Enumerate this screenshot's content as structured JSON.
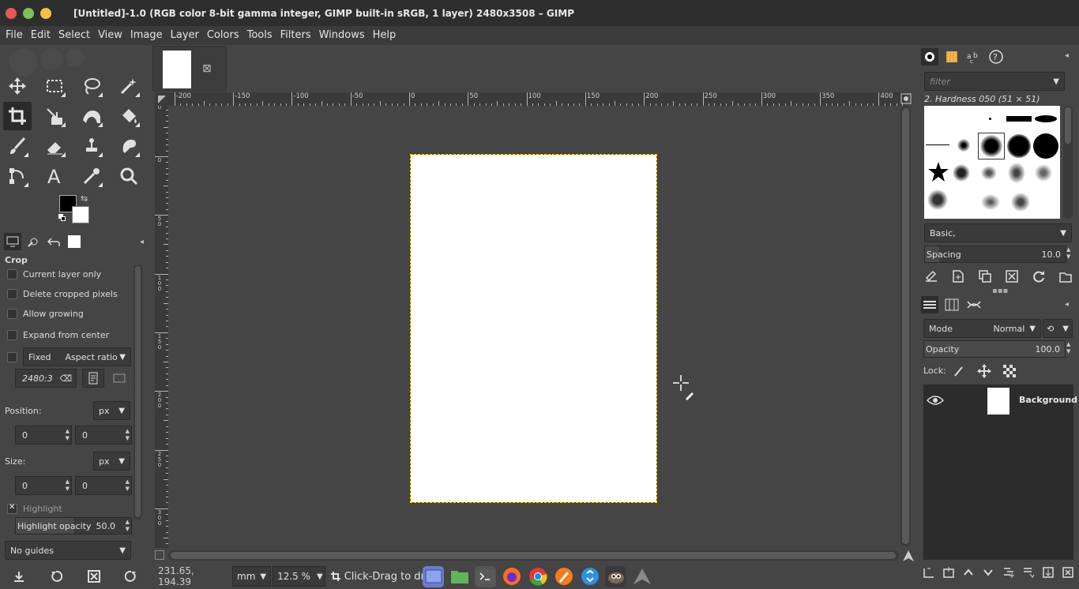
{
  "window": {
    "title": "[Untitled]-1.0 (RGB color 8-bit gamma integer, GIMP built-in sRGB, 1 layer) 2480x3508 – GIMP",
    "controls": [
      {
        "name": "close",
        "color": "#e35a5a"
      },
      {
        "name": "maximize",
        "color": "#7cc35a"
      },
      {
        "name": "minimize",
        "color": "#f2c14e"
      }
    ]
  },
  "menu": [
    "File",
    "Edit",
    "Select",
    "View",
    "Image",
    "Layer",
    "Colors",
    "Tools",
    "Filters",
    "Windows",
    "Help"
  ],
  "toolbox": {
    "tools": [
      "move-icon",
      "rect-select-icon",
      "lasso-icon",
      "fuzzy-select-icon",
      "crop-icon",
      "transform-icon",
      "warp-icon",
      "bucket-fill-icon",
      "paintbrush-icon",
      "eraser-icon",
      "clone-icon",
      "smudge-icon",
      "paths-icon",
      "text-icon",
      "color-picker-icon",
      "zoom-icon"
    ],
    "active_tool": "crop-icon",
    "fg_color": "#000000",
    "bg_color": "#ffffff"
  },
  "tool_options": {
    "title": "Crop",
    "current_layer_only": "Current layer only",
    "delete_cropped": "Delete cropped pixels",
    "allow_growing": "Allow growing",
    "expand_center": "Expand from center",
    "fixed_label": "Fixed",
    "aspect_ratio": "Aspect ratio",
    "ratio_value": "2480:3",
    "position_label": "Position:",
    "position_unit": "px",
    "pos_x": "0",
    "pos_y": "0",
    "size_label": "Size:",
    "size_unit": "px",
    "size_w": "0",
    "size_h": "0",
    "highlight": "Highlight",
    "highlight_opacity_label": "Highlight opacity",
    "highlight_opacity": "50.0",
    "guides": "No guides"
  },
  "image_tab": {
    "close": "⊠"
  },
  "rulers": {
    "h_labels": [
      "-200",
      "-150",
      "-100",
      "-50",
      "0",
      "50",
      "100",
      "150",
      "200",
      "250",
      "300",
      "350",
      "400"
    ],
    "v_labels": [
      "50",
      "0",
      "50",
      "100",
      "150",
      "200",
      "250",
      "300"
    ]
  },
  "status": {
    "coords": "231.65, 194.39",
    "unit": "mm",
    "zoom": "12.5 %",
    "message": "Click-Drag to draw"
  },
  "taskbar": [
    "desktop-icon",
    "files-icon",
    "terminal-icon",
    "firefox-icon",
    "chrome-icon",
    "inkscape-icon",
    "trash-icon",
    "gimp-icon",
    "arch-icon"
  ],
  "brushes": {
    "filter_placeholder": "filter",
    "current": "2. Hardness 050 (51 × 51)",
    "preset": "Basic,",
    "spacing_label": "Spacing",
    "spacing_value": "10.0"
  },
  "layers": {
    "mode_label": "Mode",
    "mode_value": "Normal",
    "opacity_label": "Opacity",
    "opacity_value": "100.0",
    "lock_label": "Lock:",
    "layer_name": "Background"
  }
}
